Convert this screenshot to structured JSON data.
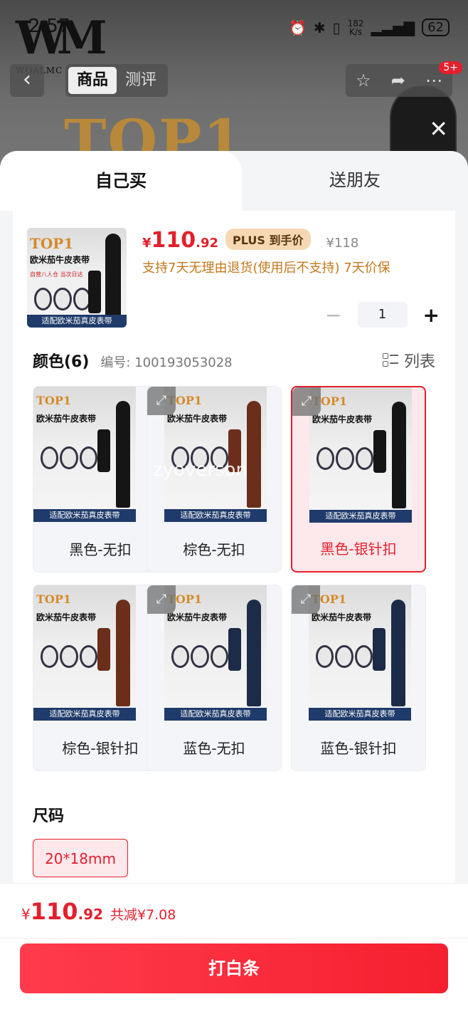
{
  "status_bar": {
    "time": "2:57",
    "net_speed_value": "182",
    "net_speed_unit": "K/s",
    "battery": "62"
  },
  "brand": {
    "logo_text": "WM",
    "name": "WOALMC"
  },
  "header": {
    "tabs": [
      {
        "label": "商品",
        "active": true
      },
      {
        "label": "测评",
        "active": false
      }
    ],
    "badge": "5+",
    "hero_text": "TOP1"
  },
  "sheet": {
    "buy_tabs": [
      {
        "label": "自己买",
        "active": true
      },
      {
        "label": "送朋友",
        "active": false
      }
    ],
    "product": {
      "image_title": "TOP1",
      "image_subtitle": "欧米茄牛皮表带",
      "image_note": "自营八人仓 当次日达",
      "image_banner": "适配欧米茄真皮表带",
      "price_currency": "¥",
      "price_int": "110",
      "price_dec": ".92",
      "plus_label": "PLUS 到手价",
      "original_price": "¥118",
      "support_text": "支持7天无理由退货(使用后不支持)  7天价保",
      "quantity": "1"
    },
    "color_section": {
      "title": "颜色(6)",
      "sku_label": "编号: 100193053028",
      "list_label": "列表",
      "options": [
        {
          "label": "黑色-无扣",
          "selected": false
        },
        {
          "label": "棕色-无扣",
          "selected": false
        },
        {
          "label": "黑色-银针扣",
          "selected": true
        },
        {
          "label": "棕色-银针扣",
          "selected": false
        },
        {
          "label": "蓝色-无扣",
          "selected": false
        },
        {
          "label": "蓝色-银针扣",
          "selected": false
        }
      ],
      "watermark": "zyoverson"
    },
    "size_section": {
      "title": "尺码",
      "options": [
        {
          "label": "20*18mm",
          "selected": true
        }
      ]
    }
  },
  "footer": {
    "total_currency": "¥",
    "total_int": "110",
    "total_dec": ".92",
    "savings": "共减¥7.08",
    "cta_label": "打白条"
  },
  "colors": {
    "accent": "#e4202c",
    "plus_bg": "#f6d9b4",
    "support_text": "#c4781c"
  }
}
